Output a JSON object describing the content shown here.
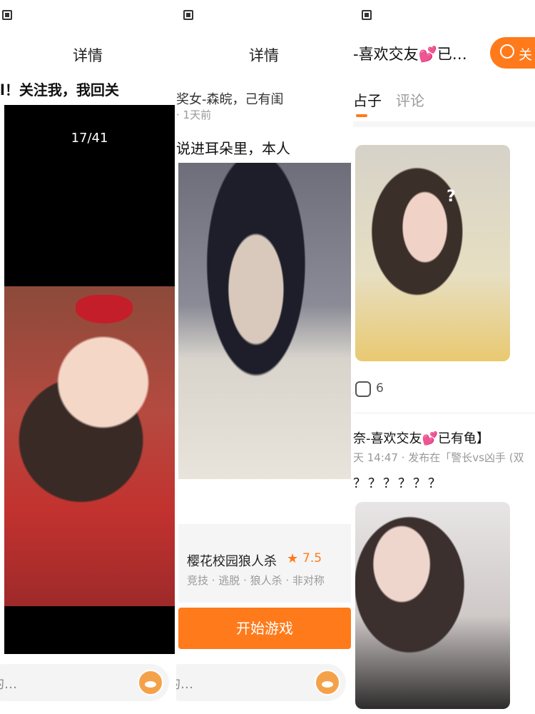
{
  "panel1": {
    "nav_title": "详情",
    "post_text": "l！关注我，我回关",
    "viewer_counter": "17/41",
    "comment_placeholder": "的…"
  },
  "panel2": {
    "nav_title": "详情",
    "author": "奖女-森皖，己有闺",
    "time": "· 1天前",
    "post_text": "说进耳朵里，本人",
    "game": {
      "name": "樱花校园狼人杀",
      "rating": "7.5",
      "tags": "竞技 · 逃脱 · 狼人杀 · 非对称",
      "play_label": "开始游戏"
    },
    "comment_placeholder": "的…"
  },
  "panel3": {
    "header_title": "-喜欢交友💕已…",
    "follow_label": "关",
    "tabs": {
      "posts": "占子",
      "comments": "评论"
    },
    "post1": {
      "comment_count": "6"
    },
    "post2": {
      "title": "奈-喜欢交友💕已有龟】",
      "meta": "天 14:47 · 发布在「警长vs凶手 (双",
      "body": "？？？？？？"
    }
  },
  "colors": {
    "accent": "#ff7a1a",
    "bg": "#ffffff",
    "muted": "#999999"
  }
}
